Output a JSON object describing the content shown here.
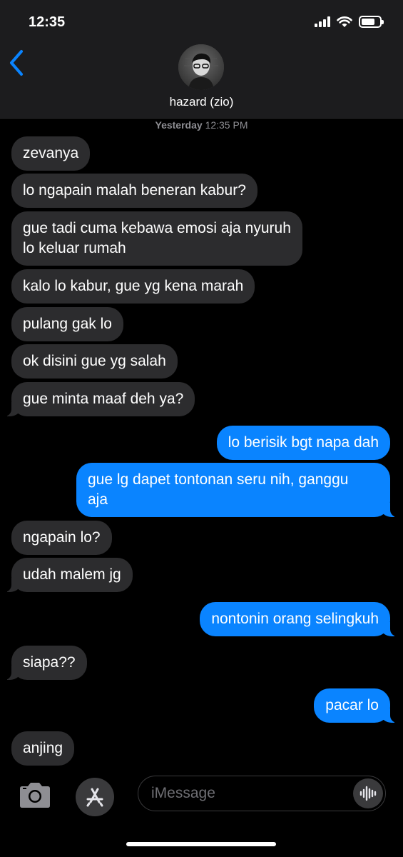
{
  "status_bar": {
    "time": "12:35"
  },
  "header": {
    "contact_name": "hazard (zio)"
  },
  "timestamp": {
    "day": "Yesterday",
    "time": "12:35 PM"
  },
  "messages": [
    {
      "from": "them",
      "text": "zevanya"
    },
    {
      "from": "them",
      "text": "lo ngapain malah beneran kabur?"
    },
    {
      "from": "them",
      "lines": [
        "gue tadi cuma kebawa emosi aja nyuruh",
        "lo keluar rumah"
      ]
    },
    {
      "from": "them",
      "text": "kalo lo kabur, gue yg kena marah"
    },
    {
      "from": "them",
      "text": "pulang gak lo"
    },
    {
      "from": "them",
      "text": "ok disini gue yg salah"
    },
    {
      "from": "them",
      "text": "gue minta maaf deh ya?"
    },
    {
      "from": "me",
      "text": "lo berisik bgt napa dah"
    },
    {
      "from": "me",
      "lines": [
        "gue lg dapet tontonan seru nih, ganggu",
        "aja"
      ]
    },
    {
      "from": "them",
      "text": "ngapain lo?"
    },
    {
      "from": "them",
      "text": "udah malem jg"
    },
    {
      "from": "me",
      "text": "nontonin orang selingkuh"
    },
    {
      "from": "them",
      "text": "siapa??"
    },
    {
      "from": "me",
      "text": "pacar lo"
    },
    {
      "from": "them",
      "text": "anjing"
    }
  ],
  "input_bar": {
    "placeholder": "iMessage"
  },
  "colors": {
    "outgoing": "#0a84ff",
    "incoming": "#2c2c2e",
    "back_chevron": "#0a84ff"
  },
  "icons": [
    "back-chevron-icon",
    "camera-icon",
    "app-store-icon",
    "audio-waveform-icon",
    "wifi-icon",
    "battery-icon",
    "signal-icon"
  ]
}
